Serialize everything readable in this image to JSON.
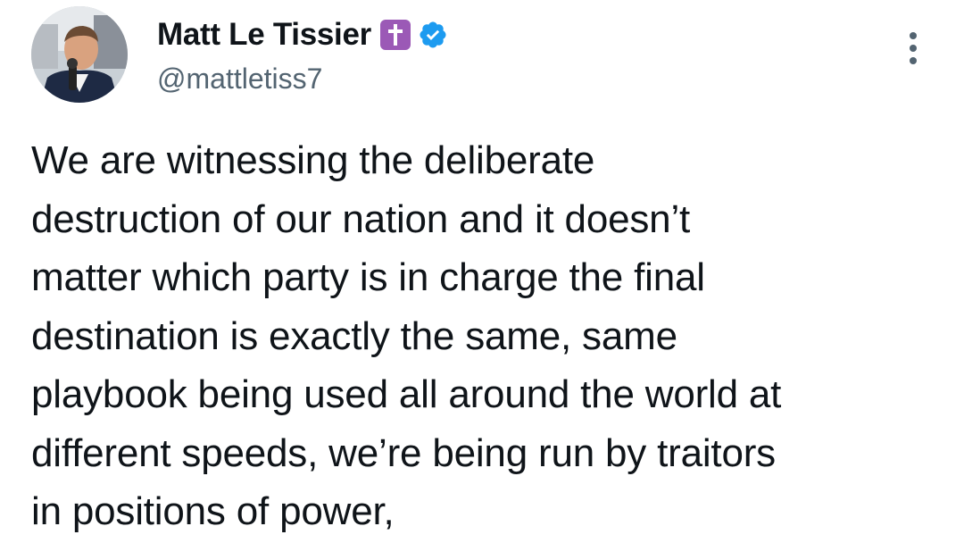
{
  "author": {
    "display_name": "Matt Le Tissier",
    "handle": "@mattletiss7",
    "avatar_icon": "profile-photo",
    "name_emoji_icon": "latin-cross-icon",
    "verified_icon": "verified-badge-icon"
  },
  "tweet": {
    "lines": [
      "We are witnessing the deliberate",
      "destruction of our nation and it doesn’t",
      "matter which party is in charge the final",
      "destination is exactly the same, same",
      "playbook being used all around the world at",
      "different speeds, we’re being run by traitors",
      "in positions of power,"
    ]
  },
  "menu": {
    "more_icon": "more-options-icon"
  },
  "colors": {
    "text": "#0f1419",
    "secondary": "#536471",
    "verified": "#1d9bf0",
    "cross_bg": "#9b59b6"
  }
}
